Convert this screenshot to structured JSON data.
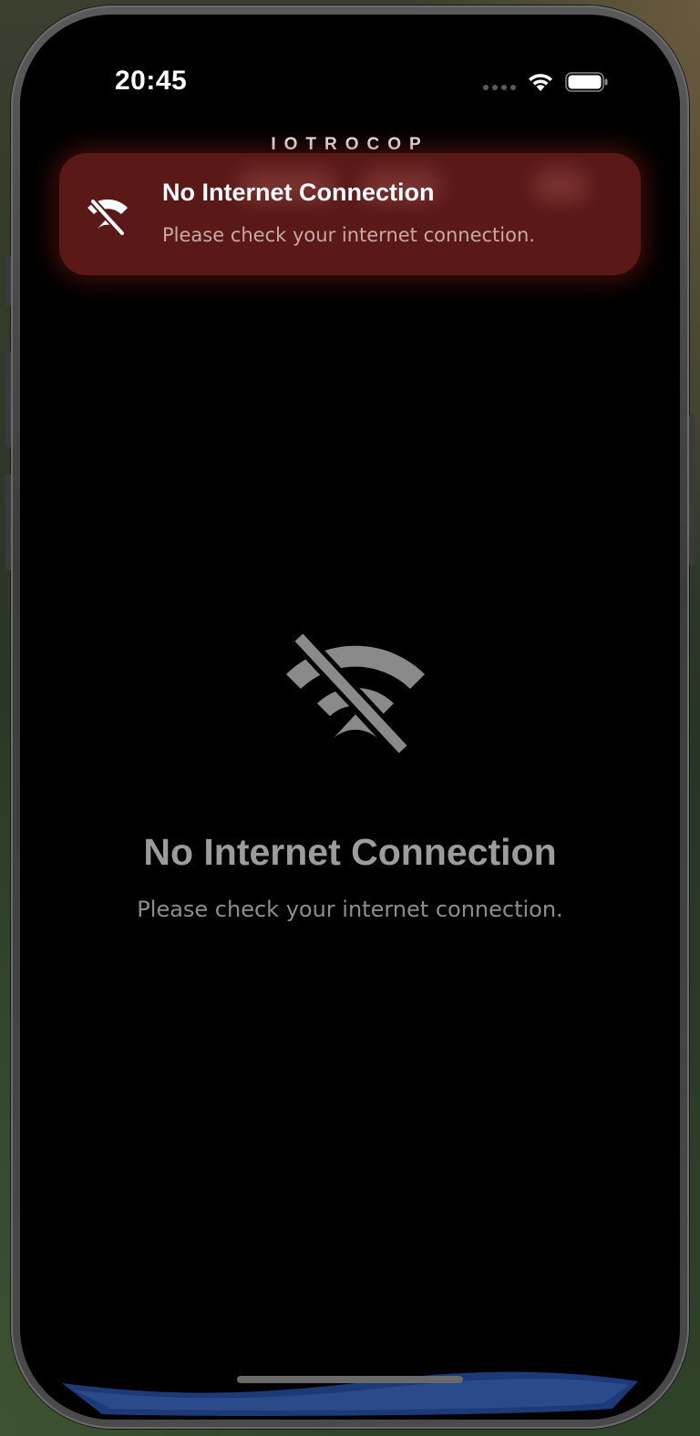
{
  "status_bar": {
    "time": "20:45",
    "signal_icon": "cellular-signal-icon",
    "wifi_icon": "wifi-icon",
    "battery_icon": "battery-icon"
  },
  "app": {
    "brand": "IOTROCOP"
  },
  "toast": {
    "icon": "wifi-off-icon",
    "title": "No Internet Connection",
    "message": "Please check your internet connection.",
    "background_color": "#5a1917"
  },
  "empty_state": {
    "icon": "wifi-off-icon",
    "title": "No Internet Connection",
    "message": "Please check your internet connection."
  },
  "colors": {
    "screen_background": "#000000",
    "toast_background": "#5a1917",
    "muted_text": "#9c9c9c",
    "bottom_accent": "#2a4a8a"
  }
}
